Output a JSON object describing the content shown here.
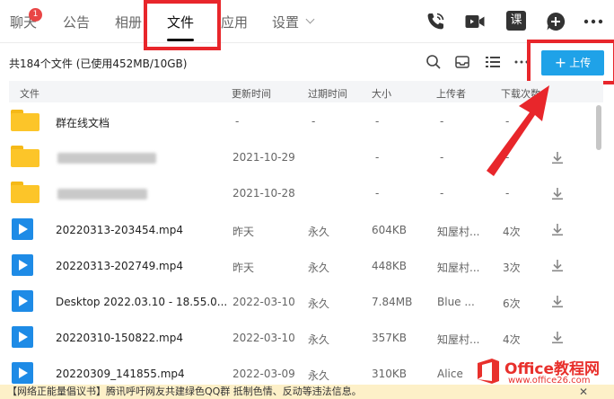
{
  "tabs": [
    {
      "label": "聊天",
      "badge": "1"
    },
    {
      "label": "公告"
    },
    {
      "label": "相册"
    },
    {
      "label": "文件",
      "active": true
    },
    {
      "label": "应用"
    },
    {
      "label": "设置"
    }
  ],
  "toolbar_icons": [
    "phone-icon",
    "video-call-icon",
    "course-icon",
    "add-icon",
    "more-icon"
  ],
  "course_icon_label": "课",
  "summary": "共184个文件 (已使用452MB/10GB)",
  "upload_label": "上传",
  "columns": [
    "文件",
    "更新时间",
    "过期时间",
    "大小",
    "上传者",
    "下载次数"
  ],
  "files": [
    {
      "type": "folder",
      "name": "群在线文档",
      "updated": "-",
      "expires": "-",
      "size": "-",
      "uploader": "-",
      "downloads": "-"
    },
    {
      "type": "folder",
      "name": "",
      "updated": "2021-10-29",
      "expires": "",
      "size": "-",
      "uploader": "-",
      "downloads": "-"
    },
    {
      "type": "folder",
      "name": "",
      "updated": "2021-10-28",
      "expires": "",
      "size": "-",
      "uploader": "-",
      "downloads": "-"
    },
    {
      "type": "video",
      "name": "20220313-203454.mp4",
      "updated": "昨天",
      "expires": "永久",
      "size": "604KB",
      "uploader": "知屋村...",
      "downloads": "4次"
    },
    {
      "type": "video",
      "name": "20220313-202749.mp4",
      "updated": "昨天",
      "expires": "永久",
      "size": "448KB",
      "uploader": "知屋村...",
      "downloads": "3次"
    },
    {
      "type": "video",
      "name": "Desktop 2022.03.10 - 18.55.0...",
      "updated": "2022-03-10",
      "expires": "永久",
      "size": "7.84MB",
      "uploader": "Blue ...",
      "downloads": "6次"
    },
    {
      "type": "video",
      "name": "20220310-150822.mp4",
      "updated": "2022-03-10",
      "expires": "永久",
      "size": "357KB",
      "uploader": "知屋村...",
      "downloads": "4次"
    },
    {
      "type": "video",
      "name": "20220309_141855.mp4",
      "updated": "2022-03-09",
      "expires": "永久",
      "size": "310KB",
      "uploader": "Alice",
      "downloads": ""
    }
  ],
  "notice": "【网络正能量倡议书】腾讯呼吁网友共建绿色QQ群 抵制色情、反动等违法信息。",
  "notice_close": "✕",
  "watermark": {
    "title": "Office教程网",
    "sub": "www.office26.com"
  },
  "colors": {
    "accent": "#1fa2e8",
    "highlight": "#e8262b",
    "folder": "#fcc529",
    "video": "#1e8be6"
  }
}
